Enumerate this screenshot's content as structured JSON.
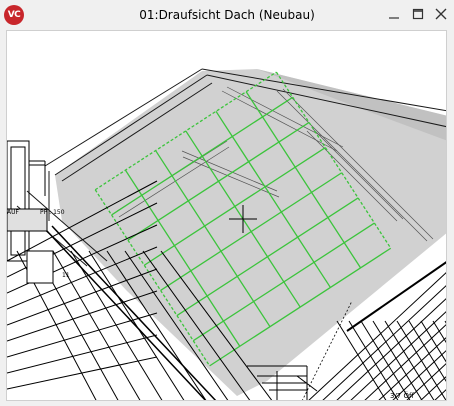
{
  "window": {
    "title": "01:Draufsicht Dach (Neubau)",
    "app_icon_text": "VC",
    "controls": [
      "minimize",
      "maximize",
      "close"
    ]
  },
  "drawing": {
    "labels": {
      "pp": "PP : 150",
      "auf": "AUF",
      "fixing_note": "3/7 Öff",
      "small_11": "11"
    },
    "colors": {
      "grid_green": "#3cc43c",
      "roof_shade": "#c8c8c8",
      "line": "#111111"
    }
  }
}
